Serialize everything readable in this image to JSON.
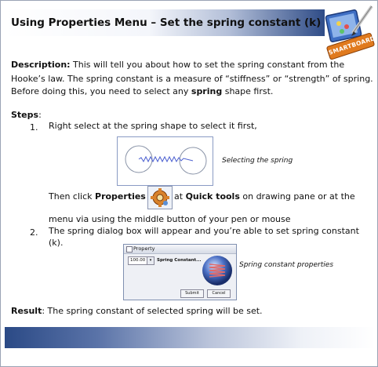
{
  "title": "Using Properties Menu – Set the spring constant (k)",
  "logo_label": "SMARTBOARD",
  "description": {
    "label": "Description:",
    "line1": " This will tell you about how to set the spring constant from the",
    "line2": "Hooke’s law. The spring constant is a measure of “stiffness” or “strength” of spring.",
    "line3_a": "Before doing this, you need to select any ",
    "line3_bold": "spring",
    "line3_b": " shape first."
  },
  "steps": {
    "label": "Steps",
    "colon": ":",
    "step1_num": "1.",
    "step1_text": "Right select at the spring shape to select it first,",
    "fig1_caption": "Selecting the spring",
    "step1b_a": "Then click ",
    "step1b_bold1": "Properties",
    "step1b_b": " at ",
    "step1b_bold2": "Quick tools",
    "step1b_c": " on drawing pane or at the",
    "step1c": "menu via using the middle button of your pen or mouse",
    "step2_num": "2.",
    "step2_line1": "The spring dialog box will appear and you’re able to set spring constant",
    "step2_line2": "(k).",
    "fig2_caption": "Spring constant properties"
  },
  "dialog": {
    "title": "Property",
    "value": "100.00",
    "dropdown_arrow": "▾",
    "field_label": "Spring Constant...",
    "submit": "Submit",
    "cancel": "Cancel"
  },
  "result": {
    "label": "Result",
    "text": ": The spring constant of selected spring will be set."
  },
  "colors": {
    "header_dark": "#2f4c87",
    "footer_dark": "#2b4a86",
    "logo_orange": "#e07a1e"
  }
}
